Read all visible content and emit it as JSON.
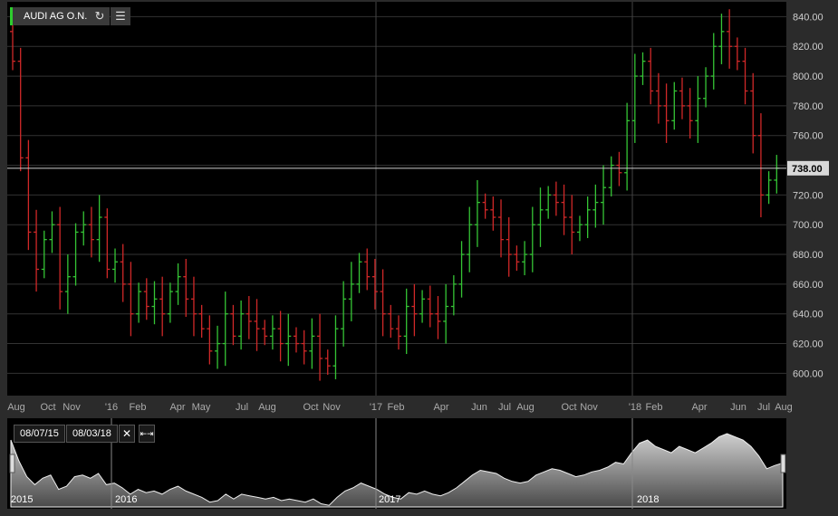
{
  "header": {
    "symbol": "AUDI AG O.N.",
    "refresh_icon": "refresh-icon",
    "indicator_icon": "chart-settings-icon"
  },
  "navigator": {
    "from_date": "08/07/15",
    "to_date": "08/03/18",
    "close_icon": "close-icon",
    "expand_icon": "expand-arrows-icon",
    "year_labels": [
      "2015",
      "2016",
      "2017",
      "2018"
    ]
  },
  "colors": {
    "background": "#000000",
    "up": "#35c435",
    "down": "#d02828",
    "grid": "#333333",
    "last_price_line": "#cccccc"
  },
  "chart_data": {
    "type": "ohlc",
    "title": "AUDI AG O.N.",
    "ylim": [
      585,
      850
    ],
    "y_ticks": [
      "600.00",
      "620.00",
      "640.00",
      "660.00",
      "680.00",
      "700.00",
      "720.00",
      "740.00",
      "760.00",
      "780.00",
      "800.00",
      "820.00",
      "840.00"
    ],
    "last_price": "738.00",
    "x_ticks": [
      "Aug",
      "Oct",
      "Nov",
      "'16",
      "Feb",
      "Apr",
      "May",
      "Jul",
      "Aug",
      "Oct",
      "Nov",
      "'17",
      "Feb",
      "Apr",
      "Jun",
      "Jul",
      "Aug",
      "Oct",
      "Nov",
      "'18",
      "Feb",
      "Apr",
      "Jun",
      "Jul",
      "Aug"
    ],
    "date_range": [
      "2015-08-07",
      "2018-08-03"
    ],
    "weekly_close": [
      810,
      745,
      695,
      670,
      690,
      700,
      655,
      665,
      695,
      700,
      690,
      705,
      670,
      675,
      660,
      640,
      655,
      645,
      650,
      640,
      655,
      665,
      650,
      640,
      630,
      615,
      620,
      640,
      625,
      640,
      635,
      630,
      625,
      630,
      620,
      625,
      620,
      615,
      625,
      610,
      605,
      630,
      650,
      660,
      675,
      665,
      655,
      640,
      630,
      625,
      645,
      640,
      650,
      640,
      635,
      645,
      660,
      680,
      700,
      715,
      710,
      705,
      690,
      680,
      675,
      680,
      700,
      710,
      720,
      715,
      705,
      695,
      700,
      710,
      715,
      725,
      740,
      735,
      770,
      800,
      810,
      790,
      780,
      770,
      790,
      780,
      770,
      785,
      800,
      820,
      830,
      820,
      810,
      790,
      760,
      720,
      730,
      738
    ]
  }
}
